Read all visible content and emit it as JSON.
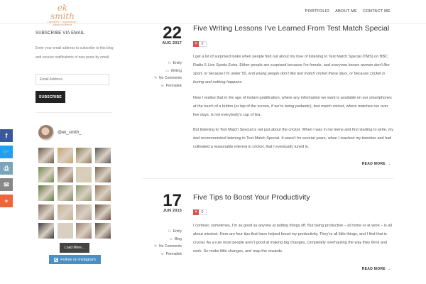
{
  "header": {
    "logo_main": "ek smith",
    "logo_sub": "cupcakes • copywriting • cakeprovidence",
    "nav": [
      "PORTFOLIO",
      "ABOUT ME",
      "CONTACT ME"
    ]
  },
  "sidebar": {
    "subscribe_heading": "SUBSCRIBE VIA EMAIL",
    "subscribe_text": "Enter your email address to subscribe to this blog and receive notifications of new posts by email.",
    "email_placeholder": "Email Address",
    "subscribe_button": "SUBSCRIBE",
    "instagram_handle": "@ek_smith_",
    "load_more": "Load More...",
    "follow_label": "Follow on Instagram",
    "thumbnail_colors": [
      [
        "#6b5a4a",
        "#c9a46a",
        "#8a7a52",
        "#5a5a5a"
      ],
      [
        "#6e8c4a",
        "#8a6e55",
        "#d6c9a8",
        "#7a6655"
      ],
      [
        "#5e7a3e",
        "#7e8a5e",
        "#8c9a6a",
        "#9a7a5a"
      ],
      [
        "#7a6a5a",
        "#c8b090",
        "#b0a090",
        "#6a5040"
      ],
      [
        "#3a3a3a",
        "#d8cfc0",
        "#9a7a6a",
        "#5a4a40"
      ]
    ]
  },
  "share": {
    "buttons": [
      {
        "icon": "facebook-icon",
        "glyph": "f",
        "color": "#3b5998"
      },
      {
        "icon": "twitter-icon",
        "glyph": "🐦",
        "color": "#1da1f2"
      },
      {
        "icon": "print-icon",
        "glyph": "⎙",
        "color": "#7aa4b8"
      },
      {
        "icon": "email-icon",
        "glyph": "✉",
        "color": "#888888"
      },
      {
        "icon": "share-more-icon",
        "glyph": "+",
        "color": "#f0643c"
      }
    ]
  },
  "posts": [
    {
      "day": "22",
      "month": "AUG 2017",
      "author": "Emily",
      "category": "Writing",
      "comments": "No Comments",
      "permalink": "Permalink",
      "title": "Five Writing Lessons I’ve Learned From Test Match Special",
      "likes": "0",
      "p1_a": "I get a lot of surprised looks when people find out about my love of listening to Test Match Special (TMS) on BBC Radio 5 Live Sports Extra. Either people are surprised because I’m female, and ",
      "p1_em1": "everyone knows women don’t like sport",
      "p1_b": ", or because I’m under 50, and ",
      "p1_em2": "young people don’t like test match cricket these days",
      "p1_c": ", or because ",
      "p1_em3": "cricket is boring and nothing happens.",
      "p2": "Now I realise that in the age of instant gratification, where any information we want is available on our smartphones at the touch of a button (or tap of the screen, if we’re being pedantic), test match cricket, where matches run over five days, is not everybody’s cup of tea.",
      "p3": "But listening to Test Match Special is not just about the cricket. When I was in my teens and first starting to write, my dad recommended listening to Test Match Special. It wasn’t for several years, when I reached my twenties and had cultivated a reasonable interest in cricket, that I eventually tuned in.",
      "read_more": "READ MORE →"
    },
    {
      "day": "17",
      "month": "JUN 2015",
      "author": "Emily",
      "category": "Blog",
      "comments": "No Comments",
      "permalink": "Permalink",
      "title": "Five Tips to Boost Your Productivity",
      "likes": "0",
      "p1": "I confess: sometimes, I’m as good as anyone at putting things off. But being productive – at home or at work – is all about mindset. Here are four tips that have helped boost my productivity. They’re all little things, and I find that is crucial. As a rule most people aren’t good at making big changes, completely overhauling the way they think and work. So make little changes, and reap the rewards.",
      "read_more": "READ MORE →"
    }
  ]
}
